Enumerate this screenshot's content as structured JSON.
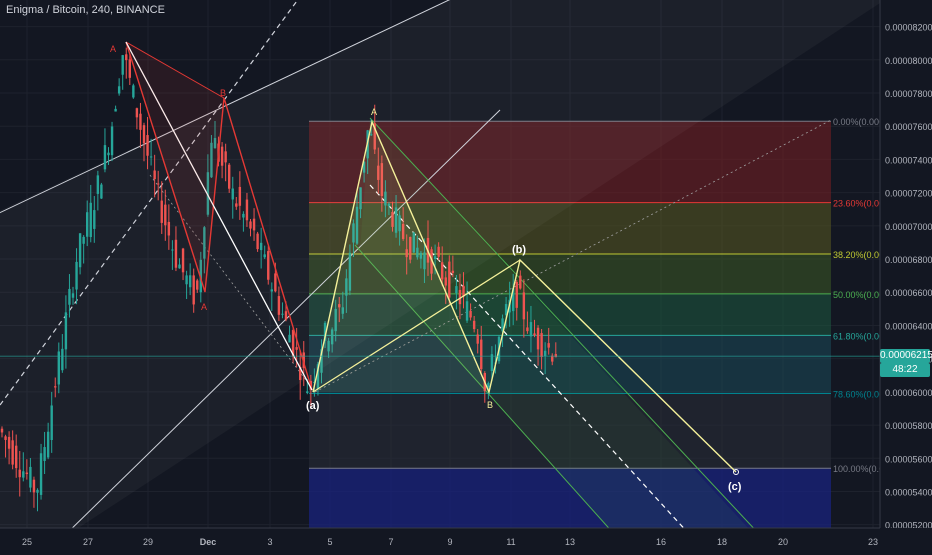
{
  "header": {
    "title": "Enigma / Bitcoin, 240, BINANCE"
  },
  "badges": {
    "last_price": "0.00006215",
    "countdown": "48:22"
  },
  "colors": {
    "background": "#131722",
    "up": "#26a69a",
    "down": "#ef5350",
    "pattern_yellow": "#f5f19a",
    "pattern_red": "#e53935",
    "channel_green": "#4caf50",
    "badge_blue": "#2a6f97"
  },
  "chart_data": {
    "type": "candlestick",
    "x_ticks": [
      "25",
      "27",
      "29",
      "Dec",
      "3",
      "5",
      "7",
      "9",
      "11",
      "13",
      "16",
      "18",
      "20",
      "23"
    ],
    "y_ticks": [
      "0.00008200",
      "0.00008000",
      "0.00007800",
      "0.00007600",
      "0.00007400",
      "0.00007200",
      "0.00007000",
      "0.00006800",
      "0.00006600",
      "0.00006400",
      "0.00006200",
      "0.00006000",
      "0.00005800",
      "0.00005600",
      "0.00005400",
      "0.00005200"
    ],
    "ylim": [
      5.18e-05,
      8.3e-05
    ],
    "fib_levels": [
      {
        "label": "0.00%(0.0000",
        "value": 7.63e-05,
        "color": "#787b86"
      },
      {
        "label": "23.60%(0.000",
        "value": 7.14e-05,
        "color": "#e53935"
      },
      {
        "label": "38.20%(0.000",
        "value": 6.83e-05,
        "color": "#c0ca33"
      },
      {
        "label": "50.00%(0.000",
        "value": 6.59e-05,
        "color": "#4caf50"
      },
      {
        "label": "61.80%(0.000",
        "value": 6.34e-05,
        "color": "#26a69a"
      },
      {
        "label": "78.60%(0.000",
        "value": 5.99e-05,
        "color": "#00838f"
      },
      {
        "label": "100.00%(0.00",
        "value": 5.54e-05,
        "color": "#787b86"
      }
    ],
    "pattern_labels": {
      "a_top_left": "A",
      "b_top_left": "B",
      "a_left_low": "A",
      "a_wave": "(a)",
      "a_top": "A",
      "b_wave": "(b)",
      "b_low": "B",
      "c_wave": "(c)"
    }
  }
}
